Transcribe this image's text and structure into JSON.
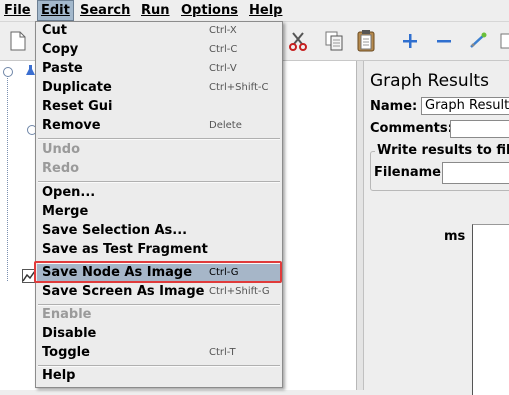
{
  "menubar": {
    "items": [
      "File",
      "Edit",
      "Search",
      "Run",
      "Options",
      "Help"
    ]
  },
  "toolbar": {
    "icons": [
      "new-icon",
      "cut-icon",
      "copy-icon",
      "paste-icon",
      "expand-icon",
      "collapse-icon",
      "toggle-icon"
    ]
  },
  "right_panel": {
    "title": "Graph Results",
    "name_label": "Name:",
    "name_value": "Graph Results",
    "comments_label": "Comments:",
    "group_title": "Write results to file",
    "filename_label": "Filename",
    "axis_label": "ms"
  },
  "edit_menu": {
    "items": [
      {
        "label": "Cut",
        "shortcut": "Ctrl-X",
        "enabled": true
      },
      {
        "label": "Copy",
        "shortcut": "Ctrl-C",
        "enabled": true
      },
      {
        "label": "Paste",
        "shortcut": "Ctrl-V",
        "enabled": true
      },
      {
        "label": "Duplicate",
        "shortcut": "Ctrl+Shift-C",
        "enabled": true
      },
      {
        "label": "Reset Gui",
        "shortcut": "",
        "enabled": true
      },
      {
        "label": "Remove",
        "shortcut": "Delete",
        "enabled": true
      },
      {
        "label": "Undo",
        "shortcut": "",
        "enabled": false
      },
      {
        "label": "Redo",
        "shortcut": "",
        "enabled": false
      },
      {
        "label": "Open...",
        "shortcut": "",
        "enabled": true
      },
      {
        "label": "Merge",
        "shortcut": "",
        "enabled": true
      },
      {
        "label": "Save Selection As...",
        "shortcut": "",
        "enabled": true
      },
      {
        "label": "Save as Test Fragment",
        "shortcut": "",
        "enabled": true
      },
      {
        "label": "Save Node As Image",
        "shortcut": "Ctrl-G",
        "enabled": true,
        "highlighted": true
      },
      {
        "label": "Save Screen As Image",
        "shortcut": "Ctrl+Shift-G",
        "enabled": true
      },
      {
        "label": "Enable",
        "shortcut": "",
        "enabled": false
      },
      {
        "label": "Disable",
        "shortcut": "",
        "enabled": true
      },
      {
        "label": "Toggle",
        "shortcut": "Ctrl-T",
        "enabled": true
      },
      {
        "label": "Help",
        "shortcut": "",
        "enabled": true
      }
    ]
  },
  "colors": {
    "highlight": "#a6b6c8",
    "callout_border": "#e03b3b"
  }
}
